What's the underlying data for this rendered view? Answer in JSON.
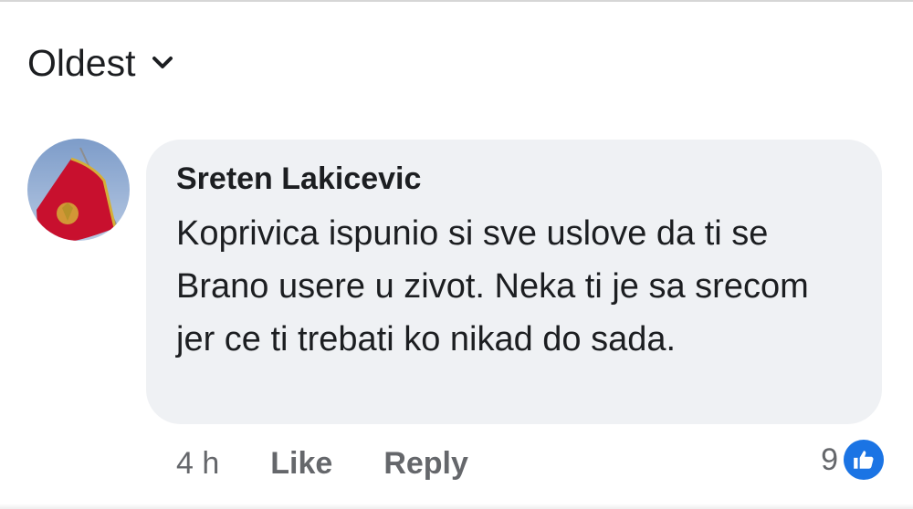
{
  "sort": {
    "label": "Oldest",
    "icon": "chevron-down-icon"
  },
  "comment": {
    "author": "Sreten Lakicevic",
    "avatar_icon": "montenegro-flag-avatar",
    "text": "Koprivica ispunio si sve uslove da ti se Brano usere u zivot. Neka ti je sa srecom jer ce ti trebati ko nikad do sada.",
    "timestamp": "4 h",
    "like_label": "Like",
    "reply_label": "Reply",
    "reaction_count": "9",
    "reaction_icon": "like-icon"
  },
  "colors": {
    "bubble": "#eff1f4",
    "text": "#1c1e21",
    "secondary_text": "#65676b",
    "like_blue": "#1b74e4",
    "flag_red": "#c8102e",
    "flag_gold": "#d4af37"
  }
}
